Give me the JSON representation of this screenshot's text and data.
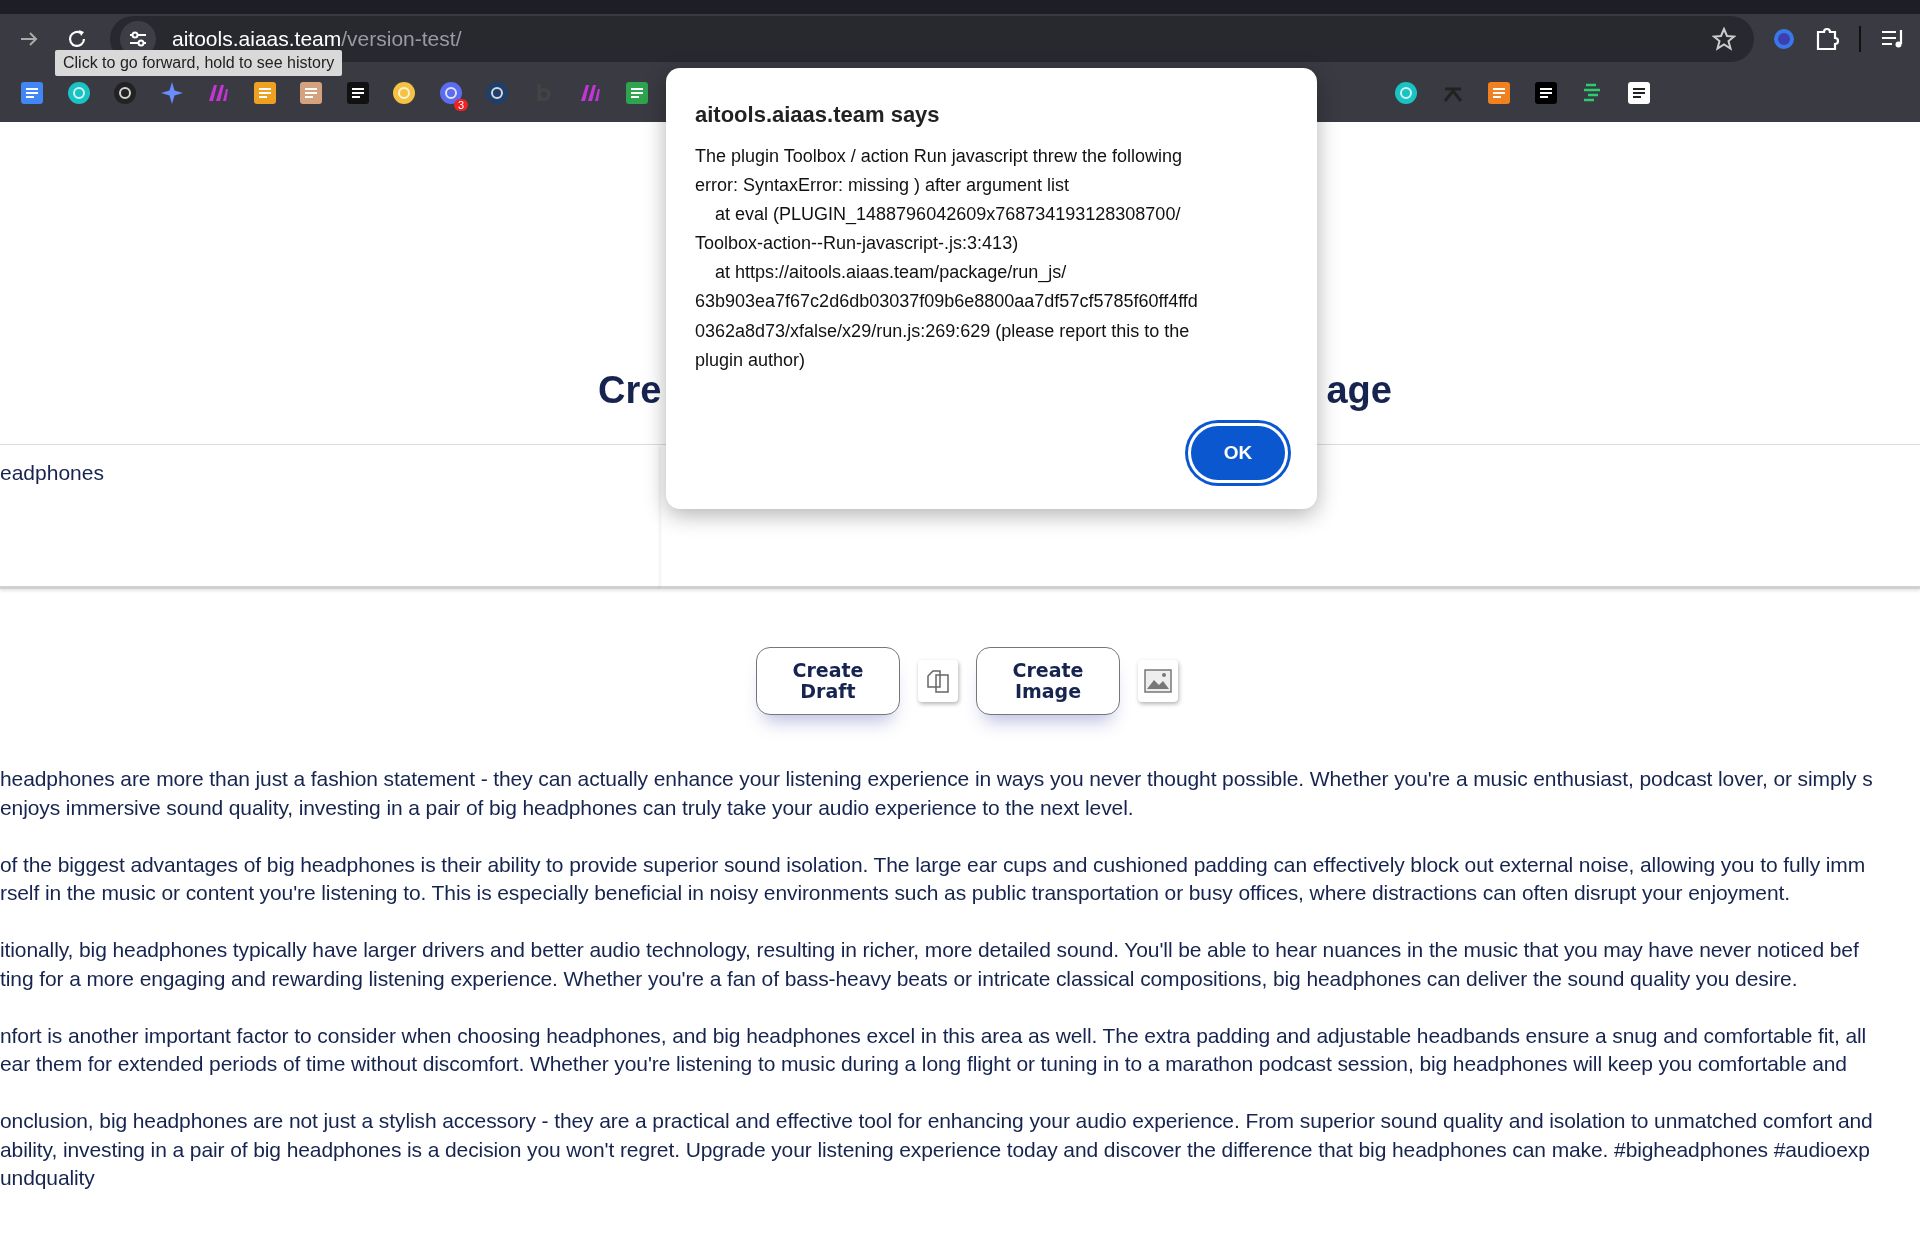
{
  "browser": {
    "url_host": "aitools.aiaas.team",
    "url_path": "/version-test/",
    "tooltip": "Click to go forward, hold to see history",
    "bookmark_badge": "3"
  },
  "page": {
    "heading_left": "Cre",
    "heading_right": "age",
    "prompt_value": "eadphones",
    "buttons": [
      {
        "kind": "text",
        "label": "Create Draft"
      },
      {
        "kind": "copy"
      },
      {
        "kind": "text",
        "label": "Create Image"
      },
      {
        "kind": "image"
      }
    ],
    "paragraphs": [
      [
        "headphones are more than just a fashion statement - they can actually enhance your listening experience in ways you never thought possible. Whether you're a music enthusiast, podcast lover, or simply s",
        "enjoys immersive sound quality, investing in a pair of big headphones can truly take your audio experience to the next level."
      ],
      [
        "of the biggest advantages of big headphones is their ability to provide superior sound isolation. The large ear cups and cushioned padding can effectively block out external noise, allowing you to fully imm",
        "rself in the music or content you're listening to. This is especially beneficial in noisy environments such as public transportation or busy offices, where distractions can often disrupt your enjoyment."
      ],
      [
        "itionally, big headphones typically have larger drivers and better audio technology, resulting in richer, more detailed sound. You'll be able to hear nuances in the music that you may have never noticed bef",
        "ting for a more engaging and rewarding listening experience. Whether you're a fan of bass-heavy beats or intricate classical compositions, big headphones can deliver the sound quality you desire."
      ],
      [
        "nfort is another important factor to consider when choosing headphones, and big headphones excel in this area as well. The extra padding and adjustable headbands ensure a snug and comfortable fit, all",
        "ear them for extended periods of time without discomfort. Whether you're listening to music during a long flight or tuning in to a marathon podcast session, big headphones will keep you comfortable and"
      ],
      [
        "onclusion, big headphones are not just a stylish accessory - they are a practical and effective tool for enhancing your audio experience. From superior sound quality and isolation to unmatched comfort and",
        "ability, investing in a pair of big headphones is a decision you won't regret. Upgrade your listening experience today and discover the difference that big headphones can make. #bigheadphones #audioexp",
        "undquality"
      ]
    ]
  },
  "dialog": {
    "title": "aitools.aiaas.team says",
    "message": "The plugin Toolbox / action Run javascript threw the following\nerror: SyntaxError: missing ) after argument list\n    at eval (PLUGIN_1488796042609x768734193128308700/\nToolbox-action--Run-javascript-.js:3:413)\n    at https://aitools.aiaas.team/package/run_js/\n63b903ea7f67c2d6db03037f09b6e8800aa7df57cf5785f60ff4ffd\n0362a8d73/xfalse/x29/run.js:269:629 (please report this to the\nplugin author)",
    "ok_label": "OK"
  }
}
